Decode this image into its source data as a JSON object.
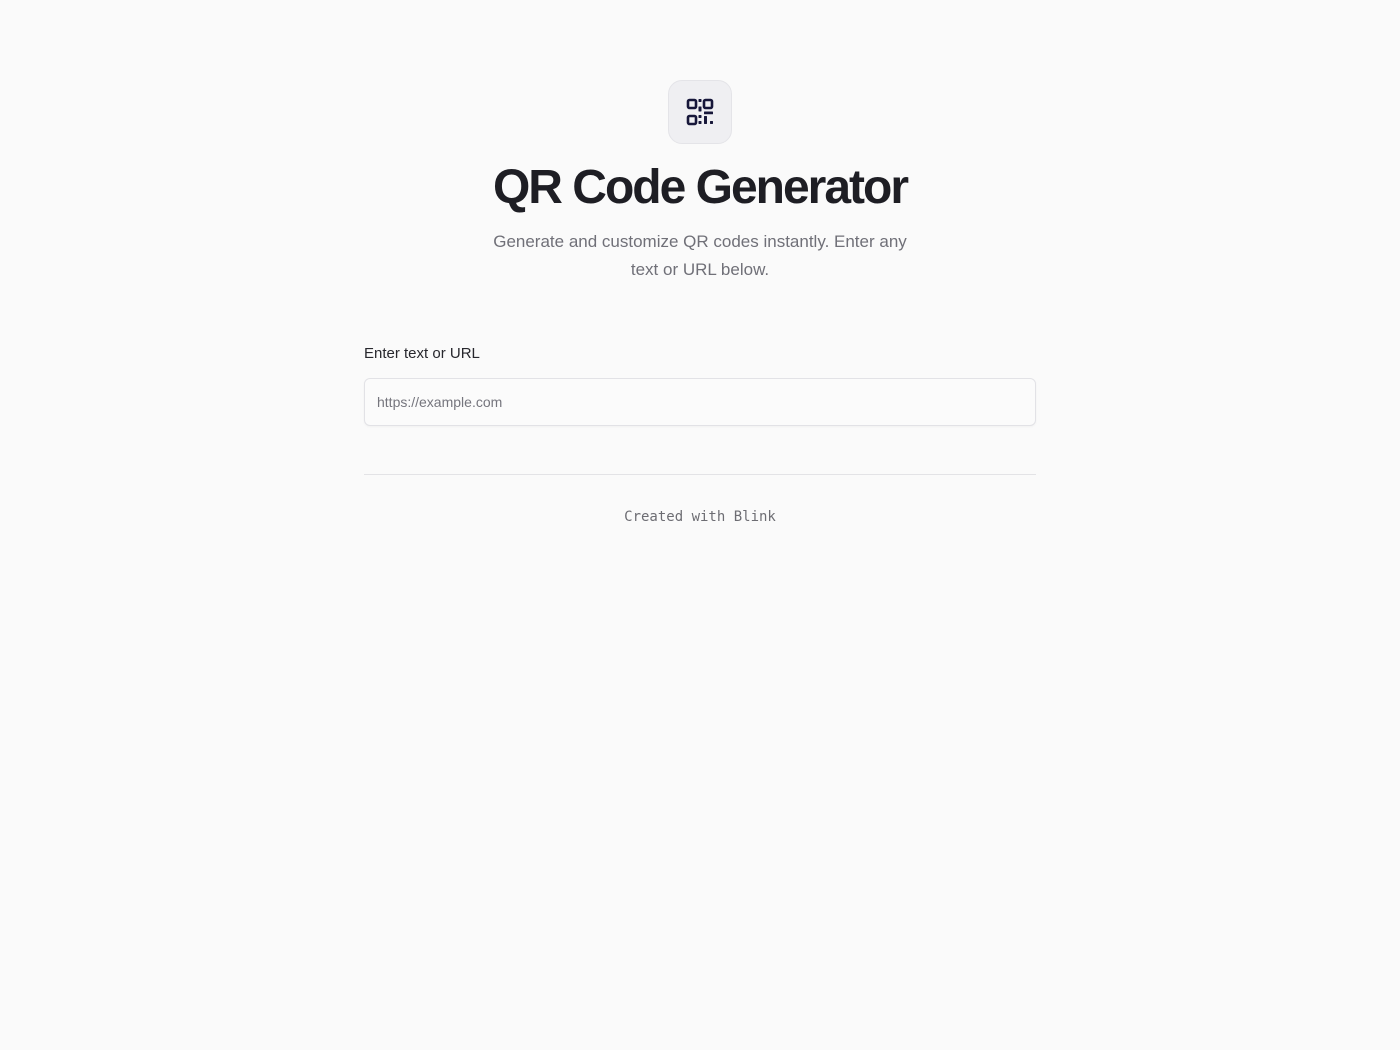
{
  "header": {
    "logo_icon": "qr-code-icon",
    "title": "QR Code Generator",
    "subtitle": "Generate and customize QR codes instantly. Enter any text or URL below."
  },
  "form": {
    "input_label": "Enter text or URL",
    "input_value": "",
    "input_placeholder": "https://example.com"
  },
  "footer": {
    "credit": "Created with Blink"
  },
  "colors": {
    "background": "#fafafa",
    "icon": "#17173a",
    "title": "#1e1e24",
    "muted_text": "#707078"
  }
}
